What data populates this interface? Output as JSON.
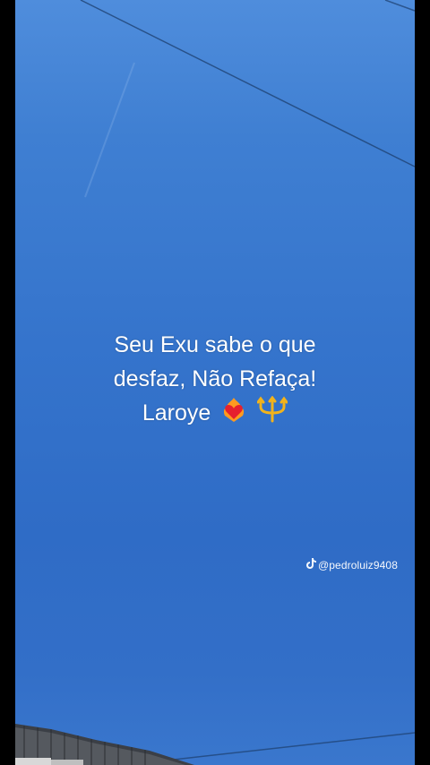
{
  "caption": {
    "line1": "Seu Exu sabe o que",
    "line2": "desfaz, Não Refaça!",
    "line3": "Laroye"
  },
  "watermark": {
    "handle": "@pedroluiz9408",
    "icon": "tiktok-icon"
  },
  "icons": [
    "heart-on-fire-icon",
    "trident-icon"
  ],
  "colors": {
    "sky": "#3574cc",
    "caption_text": "#ffffff",
    "side_bars": "#000000"
  }
}
